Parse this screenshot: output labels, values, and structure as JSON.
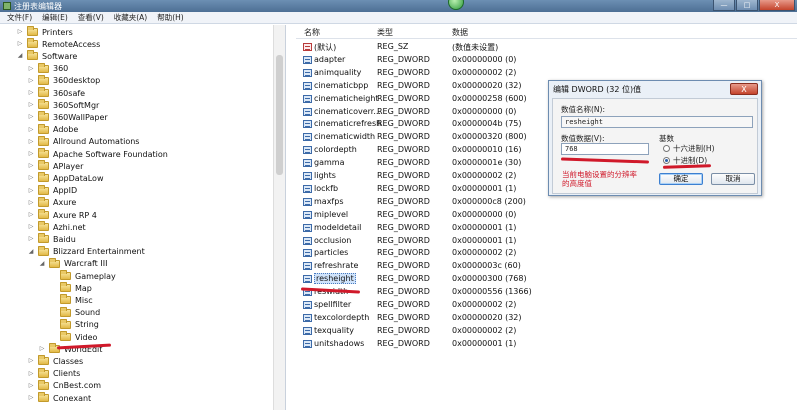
{
  "window": {
    "title": "注册表编辑器",
    "controls": {
      "minimize": "—",
      "maximize": "□",
      "close": "X"
    }
  },
  "menu": [
    "文件(F)",
    "编辑(E)",
    "查看(V)",
    "收藏夹(A)",
    "帮助(H)"
  ],
  "tree": [
    {
      "label": "Printers",
      "depth": 2,
      "expander": "▷"
    },
    {
      "label": "RemoteAccess",
      "depth": 2,
      "expander": "▷"
    },
    {
      "label": "Software",
      "depth": 2,
      "expander": "◢"
    },
    {
      "label": "360",
      "depth": 3,
      "expander": "▷"
    },
    {
      "label": "360desktop",
      "depth": 3,
      "expander": "▷"
    },
    {
      "label": "360safe",
      "depth": 3,
      "expander": "▷"
    },
    {
      "label": "360SoftMgr",
      "depth": 3,
      "expander": "▷"
    },
    {
      "label": "360WallPaper",
      "depth": 3,
      "expander": "▷"
    },
    {
      "label": "Adobe",
      "depth": 3,
      "expander": "▷"
    },
    {
      "label": "Allround Automations",
      "depth": 3,
      "expander": "▷"
    },
    {
      "label": "Apache Software Foundation",
      "depth": 3,
      "expander": "▷"
    },
    {
      "label": "APlayer",
      "depth": 3,
      "expander": "▷"
    },
    {
      "label": "AppDataLow",
      "depth": 3,
      "expander": "▷"
    },
    {
      "label": "AppID",
      "depth": 3,
      "expander": "▷"
    },
    {
      "label": "Axure",
      "depth": 3,
      "expander": "▷"
    },
    {
      "label": "Axure RP 4",
      "depth": 3,
      "expander": "▷"
    },
    {
      "label": "Azhi.net",
      "depth": 3,
      "expander": "▷"
    },
    {
      "label": "Baidu",
      "depth": 3,
      "expander": "▷"
    },
    {
      "label": "Blizzard Entertainment",
      "depth": 3,
      "expander": "◢"
    },
    {
      "label": "Warcraft III",
      "depth": 4,
      "expander": "◢"
    },
    {
      "label": "Gameplay",
      "depth": 5,
      "expander": ""
    },
    {
      "label": "Map",
      "depth": 5,
      "expander": ""
    },
    {
      "label": "Misc",
      "depth": 5,
      "expander": ""
    },
    {
      "label": "Sound",
      "depth": 5,
      "expander": ""
    },
    {
      "label": "String",
      "depth": 5,
      "expander": ""
    },
    {
      "label": "Video",
      "depth": 5,
      "expander": ""
    },
    {
      "label": "WorldEdit",
      "depth": 4,
      "expander": "▷"
    },
    {
      "label": "Classes",
      "depth": 3,
      "expander": "▷"
    },
    {
      "label": "Clients",
      "depth": 3,
      "expander": "▷"
    },
    {
      "label": "CnBest.com",
      "depth": 3,
      "expander": "▷"
    },
    {
      "label": "Conexant",
      "depth": 3,
      "expander": "▷"
    }
  ],
  "list": {
    "headers": {
      "name": "名称",
      "type": "类型",
      "data": "数据"
    },
    "rows": [
      {
        "icon": "string-value-icon",
        "name": "(默认)",
        "type": "REG_SZ",
        "data": "(数值未设置)"
      },
      {
        "icon": "dword-value-icon",
        "name": "adapter",
        "type": "REG_DWORD",
        "data": "0x00000000 (0)"
      },
      {
        "icon": "dword-value-icon",
        "name": "animquality",
        "type": "REG_DWORD",
        "data": "0x00000002 (2)"
      },
      {
        "icon": "dword-value-icon",
        "name": "cinematicbpp",
        "type": "REG_DWORD",
        "data": "0x00000020 (32)"
      },
      {
        "icon": "dword-value-icon",
        "name": "cinematicheight",
        "type": "REG_DWORD",
        "data": "0x00000258 (600)"
      },
      {
        "icon": "dword-value-icon",
        "name": "cinematicoverr...",
        "type": "REG_DWORD",
        "data": "0x00000000 (0)"
      },
      {
        "icon": "dword-value-icon",
        "name": "cinematicrefresh",
        "type": "REG_DWORD",
        "data": "0x0000004b (75)"
      },
      {
        "icon": "dword-value-icon",
        "name": "cinematicwidth",
        "type": "REG_DWORD",
        "data": "0x00000320 (800)"
      },
      {
        "icon": "dword-value-icon",
        "name": "colordepth",
        "type": "REG_DWORD",
        "data": "0x00000010 (16)"
      },
      {
        "icon": "dword-value-icon",
        "name": "gamma",
        "type": "REG_DWORD",
        "data": "0x0000001e (30)"
      },
      {
        "icon": "dword-value-icon",
        "name": "lights",
        "type": "REG_DWORD",
        "data": "0x00000002 (2)"
      },
      {
        "icon": "dword-value-icon",
        "name": "lockfb",
        "type": "REG_DWORD",
        "data": "0x00000001 (1)"
      },
      {
        "icon": "dword-value-icon",
        "name": "maxfps",
        "type": "REG_DWORD",
        "data": "0x000000c8 (200)"
      },
      {
        "icon": "dword-value-icon",
        "name": "miplevel",
        "type": "REG_DWORD",
        "data": "0x00000000 (0)"
      },
      {
        "icon": "dword-value-icon",
        "name": "modeldetail",
        "type": "REG_DWORD",
        "data": "0x00000001 (1)"
      },
      {
        "icon": "dword-value-icon",
        "name": "occlusion",
        "type": "REG_DWORD",
        "data": "0x00000001 (1)"
      },
      {
        "icon": "dword-value-icon",
        "name": "particles",
        "type": "REG_DWORD",
        "data": "0x00000002 (2)"
      },
      {
        "icon": "dword-value-icon",
        "name": "refreshrate",
        "type": "REG_DWORD",
        "data": "0x0000003c (60)"
      },
      {
        "icon": "dword-value-icon",
        "name": "resheight",
        "type": "REG_DWORD",
        "data": "0x00000300 (768)",
        "selected": true
      },
      {
        "icon": "dword-value-icon",
        "name": "reswidth",
        "type": "REG_DWORD",
        "data": "0x00000556 (1366)"
      },
      {
        "icon": "dword-value-icon",
        "name": "spellfilter",
        "type": "REG_DWORD",
        "data": "0x00000002 (2)"
      },
      {
        "icon": "dword-value-icon",
        "name": "texcolordepth",
        "type": "REG_DWORD",
        "data": "0x00000020 (32)"
      },
      {
        "icon": "dword-value-icon",
        "name": "texquality",
        "type": "REG_DWORD",
        "data": "0x00000002 (2)"
      },
      {
        "icon": "dword-value-icon",
        "name": "unitshadows",
        "type": "REG_DWORD",
        "data": "0x00000001 (1)"
      }
    ]
  },
  "dialog": {
    "title": "编辑 DWORD (32 位)值",
    "close": "X",
    "name_label": "数值名称(N):",
    "name_value": "resheight",
    "data_label": "数值数据(V):",
    "data_value": "768",
    "base_label": "基数",
    "radio_hex": "十六进制(H)",
    "radio_dec": "十进制(D)",
    "selected_base": "dec",
    "ok": "确定",
    "cancel": "取消",
    "note": "当前电脑设置的分辨率的高度值"
  },
  "colors": {
    "annotation_red": "#d0192a",
    "titlebar": "#5a7ea3",
    "selection": "#cfe3fb"
  }
}
